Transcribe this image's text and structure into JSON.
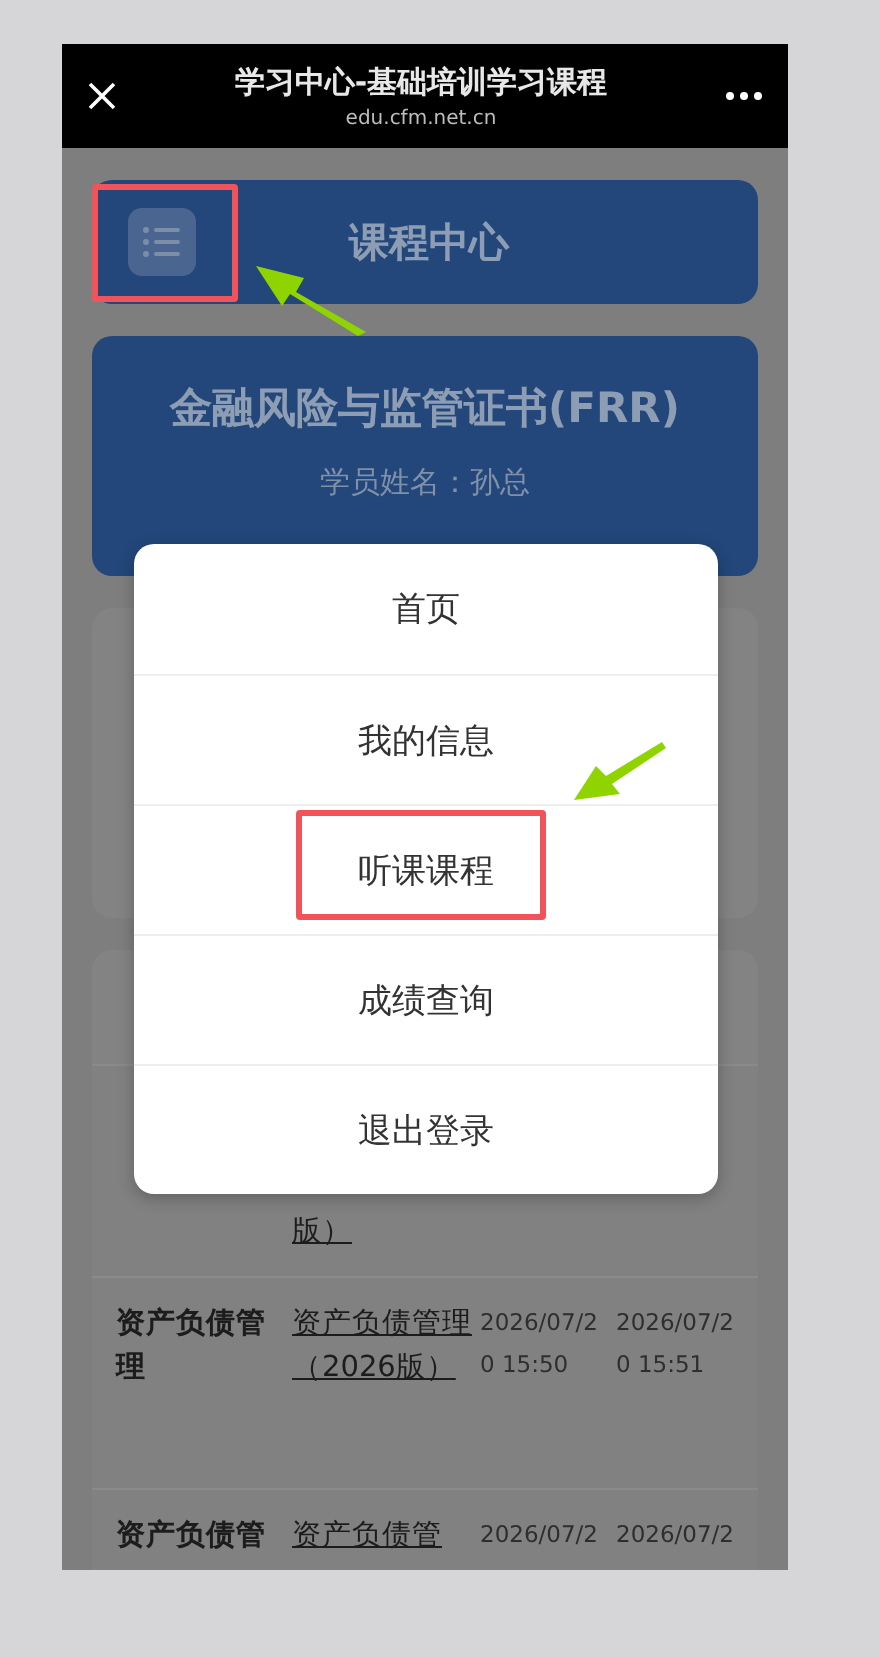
{
  "browser_bar": {
    "title": "学习中心-基础培训学习课程",
    "url": "edu.cfm.net.cn"
  },
  "header": {
    "title": "课程中心"
  },
  "profile": {
    "title": "金融风险与监管证书(FRR)",
    "student": "学员姓名：孙总"
  },
  "table": {
    "rows": [
      {
        "cells": [
          "",
          "版）",
          "",
          ""
        ]
      },
      {
        "cells": [
          "资产负债管理",
          "资产负债管理（2026版）",
          "2026/07/20 15:50",
          "2026/07/20 15:51"
        ]
      },
      {
        "cells": [
          "资产负债管",
          "资产负债管",
          "2026/07/2",
          "2026/07/2"
        ]
      }
    ]
  },
  "menu": {
    "items": [
      {
        "label": "首页",
        "selected": false
      },
      {
        "label": "我的信息",
        "selected": false
      },
      {
        "label": "听课课程",
        "selected": true
      },
      {
        "label": "成绩查询",
        "selected": false
      },
      {
        "label": "退出登录",
        "selected": false
      }
    ]
  }
}
